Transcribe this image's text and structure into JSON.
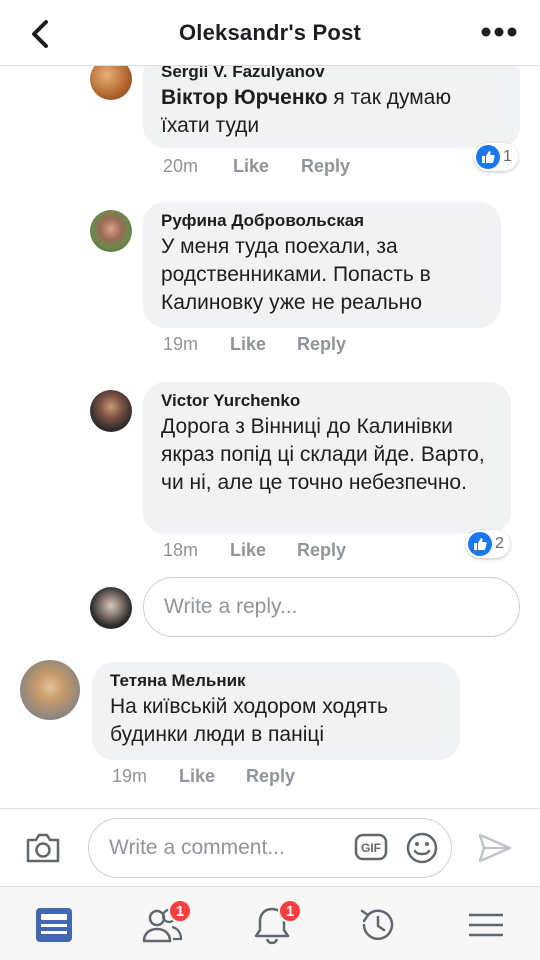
{
  "header": {
    "title": "Oleksandr's Post"
  },
  "comments": [
    {
      "author": "Sergii V. Fazulyanov",
      "mention": "Віктор Юрченко",
      "text": " я так думаю їхати туди",
      "time": "20m",
      "like": "Like",
      "reply": "Reply",
      "reactions": "1"
    },
    {
      "author": "Руфина Добровольская",
      "text": "У меня туда поехали, за родственниками. Попасть в Калиновку уже не реально",
      "time": "19m",
      "like": "Like",
      "reply": "Reply"
    },
    {
      "author": "Victor Yurchenko",
      "text": "Дорога з Вінниці до Калинівки якраз попід ці склади йде. Варто, чи ні, але це точно небезпечно.",
      "time": "18m",
      "like": "Like",
      "reply": "Reply",
      "reactions": "2"
    },
    {
      "author": "Тетяна Мельник",
      "text": "На київській ходором ходять будинки люди в паніці",
      "time": "19m",
      "like": "Like",
      "reply": "Reply"
    }
  ],
  "reply_box": {
    "placeholder": "Write a reply..."
  },
  "composer": {
    "placeholder": "Write a comment...",
    "gif_label": "GIF"
  },
  "tabbar": {
    "friends_badge": "1",
    "notifications_badge": "1"
  },
  "colors": {
    "accent": "#1877f2",
    "badge": "#fa3e3e",
    "bubble": "#f0f2f5",
    "meta": "#90949c"
  }
}
